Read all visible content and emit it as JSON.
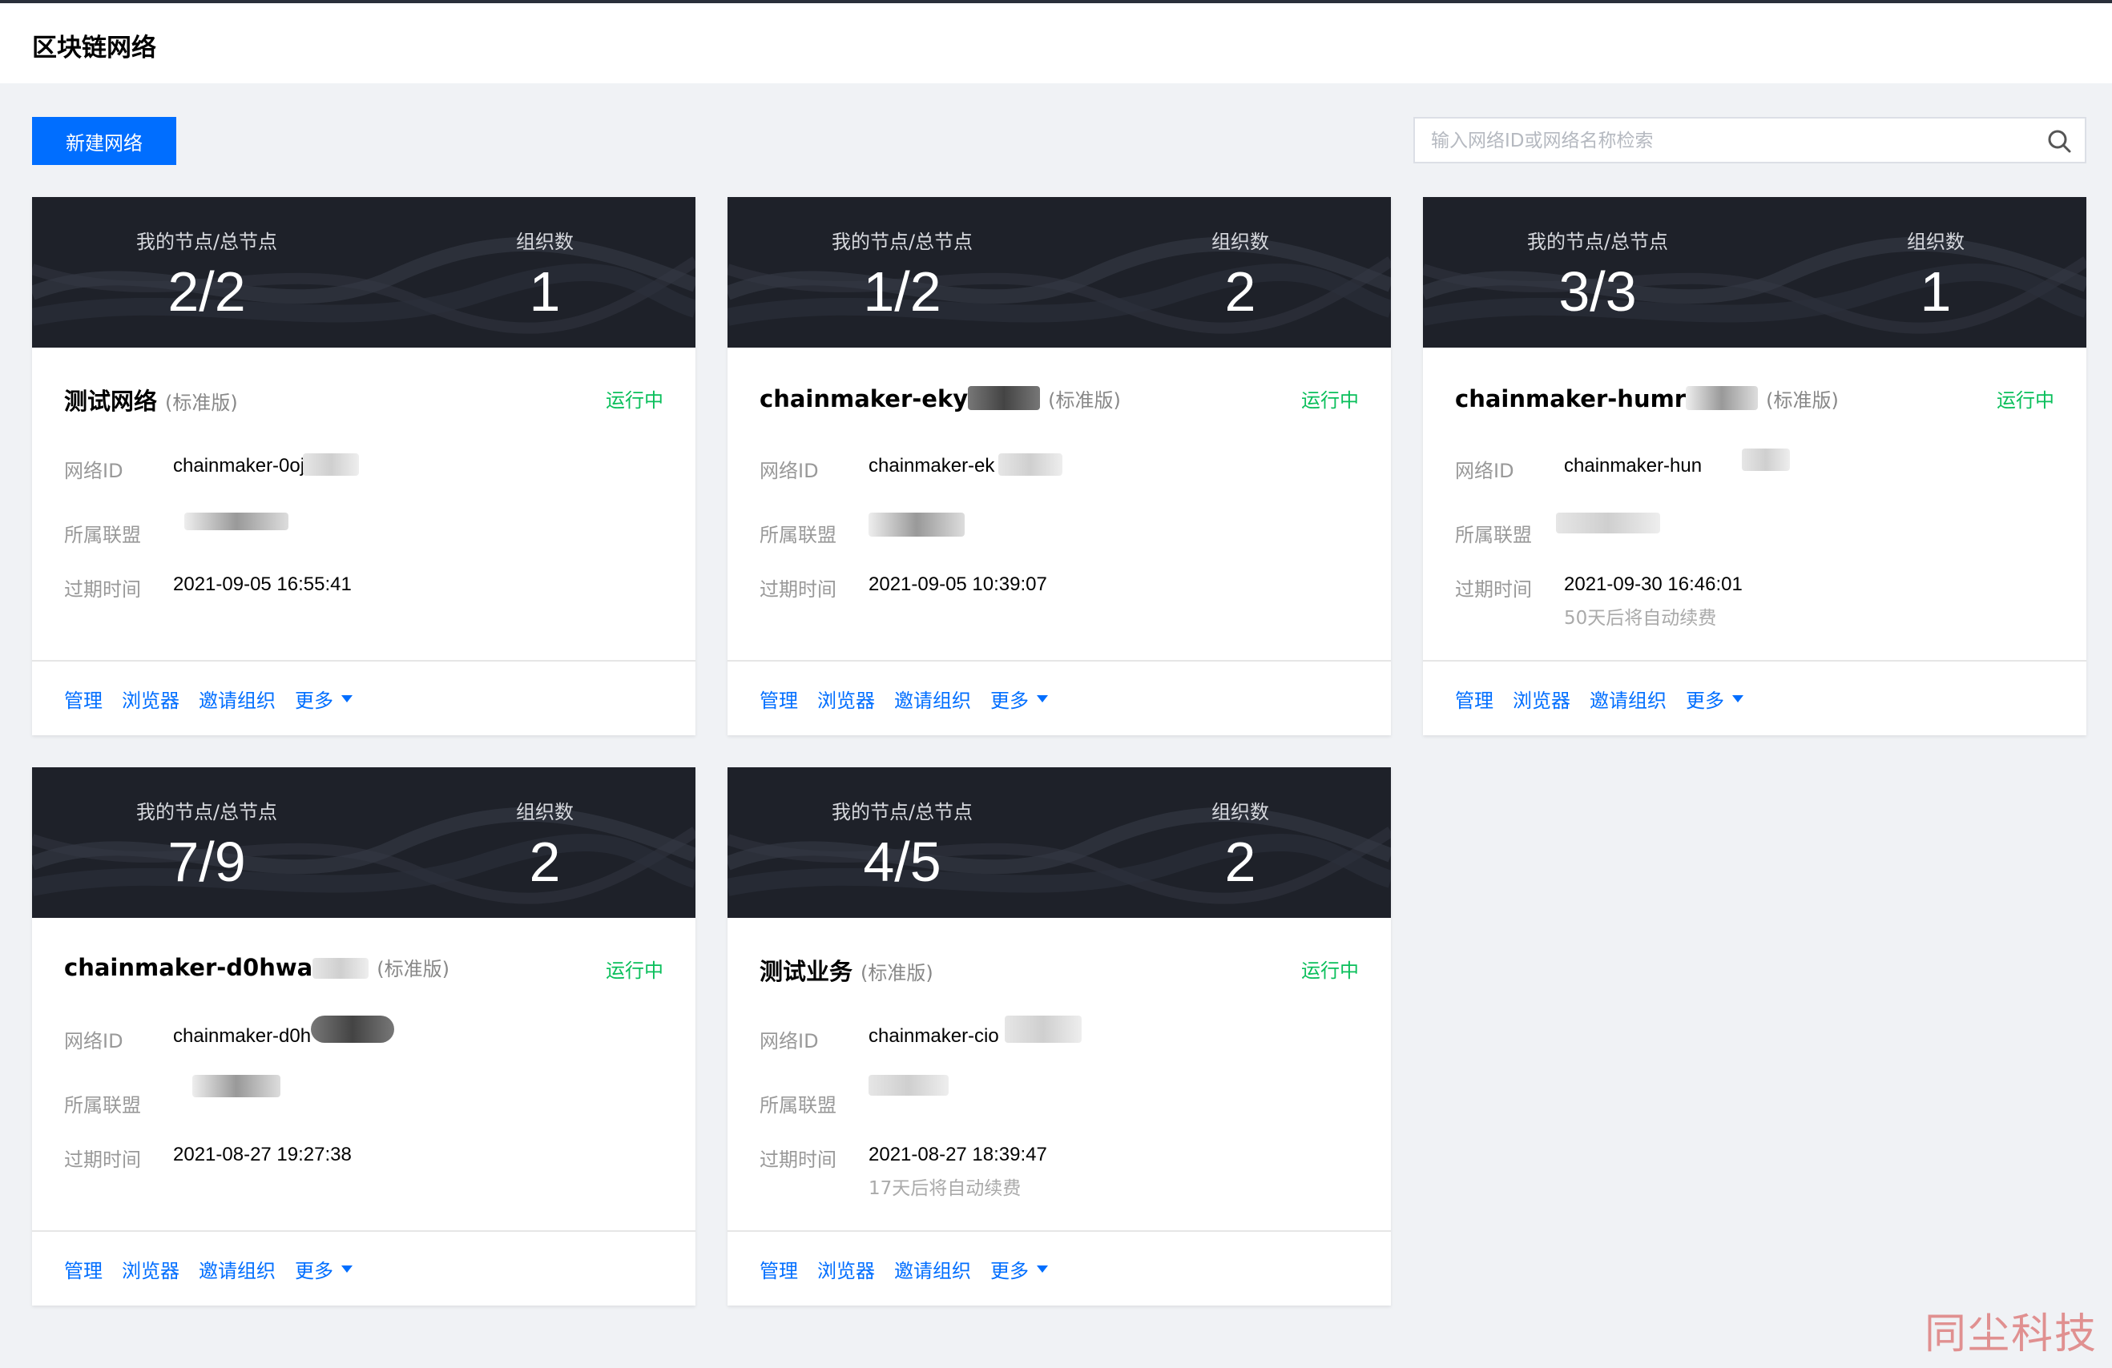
{
  "page_title": "区块链网络",
  "new_network_button": "新建网络",
  "search": {
    "placeholder": "输入网络ID或网络名称检索"
  },
  "labels": {
    "nodes": "我的节点/总节点",
    "orgs": "组织数",
    "network_id": "网络ID",
    "alliance": "所属联盟",
    "expiry": "过期时间",
    "status_running": "运行中",
    "edition": "(标准版)"
  },
  "actions": {
    "manage": "管理",
    "browser": "浏览器",
    "invite": "邀请组织",
    "more": "更多"
  },
  "cards": [
    {
      "nodes": "2/2",
      "orgs": "1",
      "name": "测试网络",
      "network_id": "chainmaker-0oj",
      "expiry": "2021-09-05 16:55:41",
      "renew": ""
    },
    {
      "nodes": "1/2",
      "orgs": "2",
      "name": "chainmaker-eky",
      "network_id": "chainmaker-ek",
      "expiry": "2021-09-05 10:39:07",
      "renew": ""
    },
    {
      "nodes": "3/3",
      "orgs": "1",
      "name": "chainmaker-humr",
      "network_id": "chainmaker-hun",
      "expiry": "2021-09-30 16:46:01",
      "renew": "50天后将自动续费"
    },
    {
      "nodes": "7/9",
      "orgs": "2",
      "name": "chainmaker-d0hwa",
      "network_id": "chainmaker-d0h",
      "expiry": "2021-08-27 19:27:38",
      "renew": ""
    },
    {
      "nodes": "4/5",
      "orgs": "2",
      "name": "测试业务",
      "network_id": "chainmaker-cio",
      "expiry": "2021-08-27 18:39:47",
      "renew": "17天后将自动续费"
    }
  ],
  "watermark": "同尘科技",
  "colors": {
    "primary": "#006eff",
    "running": "#0abf5b",
    "banner": "#1e2129",
    "background": "#f0f2f5"
  }
}
